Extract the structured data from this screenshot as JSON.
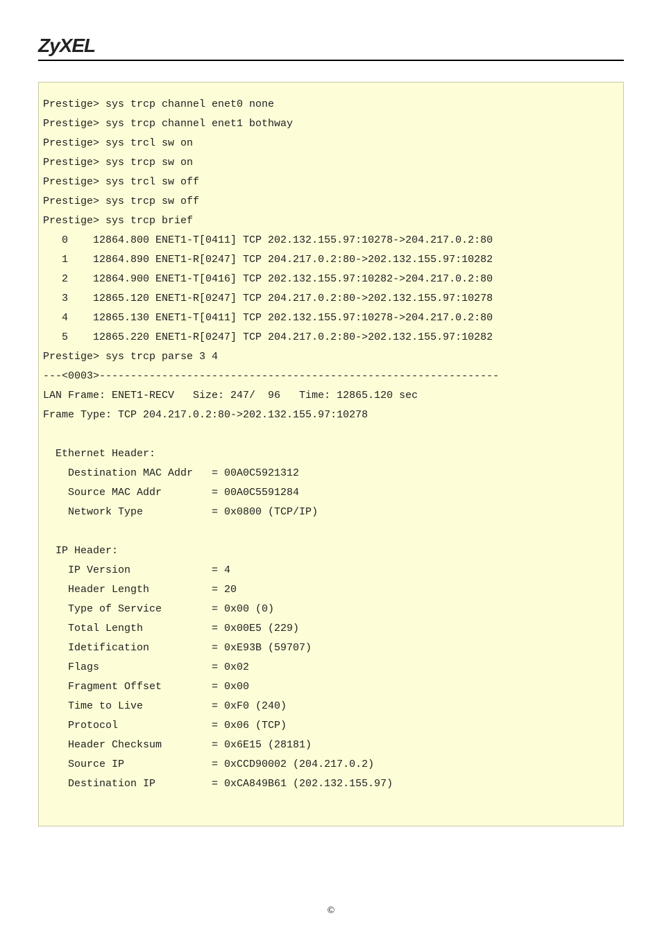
{
  "brand": "ZyXEL",
  "footer_symbol": "©",
  "terminal": {
    "lines": [
      "Prestige> sys trcp channel enet0 none",
      "Prestige> sys trcp channel enet1 bothway",
      "Prestige> sys trcl sw on",
      "Prestige> sys trcp sw on",
      "Prestige> sys trcl sw off",
      "Prestige> sys trcp sw off",
      "Prestige> sys trcp brief",
      "   0    12864.800 ENET1-T[0411] TCP 202.132.155.97:10278->204.217.0.2:80",
      "   1    12864.890 ENET1-R[0247] TCP 204.217.0.2:80->202.132.155.97:10282",
      "   2    12864.900 ENET1-T[0416] TCP 202.132.155.97:10282->204.217.0.2:80",
      "   3    12865.120 ENET1-R[0247] TCP 204.217.0.2:80->202.132.155.97:10278",
      "   4    12865.130 ENET1-T[0411] TCP 202.132.155.97:10278->204.217.0.2:80",
      "   5    12865.220 ENET1-R[0247] TCP 204.217.0.2:80->202.132.155.97:10282",
      "Prestige> sys trcp parse 3 4",
      "---<0003>----------------------------------------------------------------",
      "LAN Frame: ENET1-RECV   Size: 247/  96   Time: 12865.120 sec",
      "Frame Type: TCP 204.217.0.2:80->202.132.155.97:10278",
      "",
      "  Ethernet Header:",
      "    Destination MAC Addr   = 00A0C5921312",
      "    Source MAC Addr        = 00A0C5591284",
      "    Network Type           = 0x0800 (TCP/IP)",
      "",
      "  IP Header:",
      "    IP Version             = 4",
      "    Header Length          = 20",
      "    Type of Service        = 0x00 (0)",
      "    Total Length           = 0x00E5 (229)",
      "    Idetification          = 0xE93B (59707)",
      "    Flags                  = 0x02",
      "    Fragment Offset        = 0x00",
      "    Time to Live           = 0xF0 (240)",
      "    Protocol               = 0x06 (TCP)",
      "    Header Checksum        = 0x6E15 (28181)",
      "    Source IP              = 0xCCD90002 (204.217.0.2)",
      "    Destination IP         = 0xCA849B61 (202.132.155.97)",
      ""
    ]
  }
}
